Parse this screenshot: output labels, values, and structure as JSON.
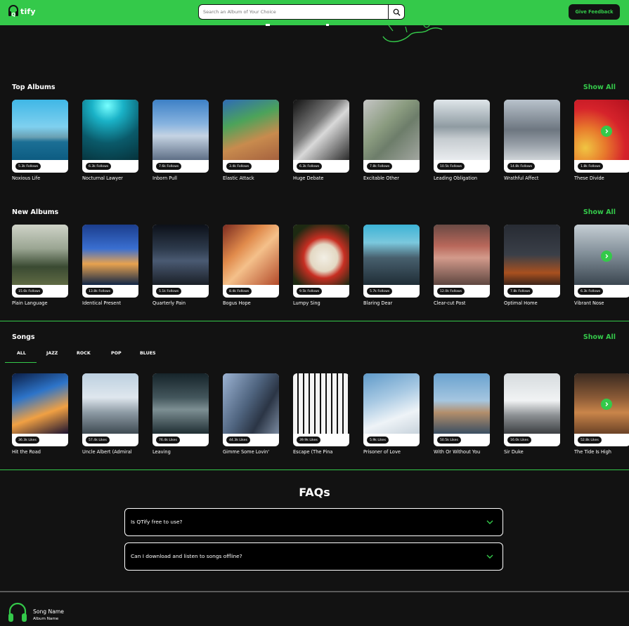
{
  "navbar": {
    "logo_text": "tify",
    "search_placeholder": "Search an Album of Your Choice",
    "feedback_label": "Give Feedback"
  },
  "colors": {
    "accent": "#34c94a",
    "background": "#121212"
  },
  "top_albums": {
    "title": "Top Albums",
    "show_all": "Show All",
    "cards": [
      {
        "title": "Noxious Life",
        "badge": "5.3k Follows"
      },
      {
        "title": "Nocturnal Lawyer",
        "badge": "6.3k Follows"
      },
      {
        "title": "Inborn Pull",
        "badge": "7.6k Follows"
      },
      {
        "title": "Elastic Attack",
        "badge": "3.4k Follows"
      },
      {
        "title": "Huge Debate",
        "badge": "6.3k Follows"
      },
      {
        "title": "Excitable Other",
        "badge": "7.8k Follows"
      },
      {
        "title": "Leading Obligation",
        "badge": "10.5k Follows"
      },
      {
        "title": "Wrathful Affect",
        "badge": "14.8k Follows"
      },
      {
        "title": "These Divide",
        "badge": "1.8k Follows"
      }
    ]
  },
  "new_albums": {
    "title": "New Albums",
    "show_all": "Show All",
    "cards": [
      {
        "title": "Plain Language",
        "badge": "15.6k Follows"
      },
      {
        "title": "Identical Present",
        "badge": "13.8k Follows"
      },
      {
        "title": "Quarterly Pain",
        "badge": "5.1k Follows"
      },
      {
        "title": "Bogus Hope",
        "badge": "8.4k Follows"
      },
      {
        "title": "Lumpy Sing",
        "badge": "9.5k Follows"
      },
      {
        "title": "Blaring Dear",
        "badge": "5.7k Follows"
      },
      {
        "title": "Clear-cut Post",
        "badge": "12.0k Follows"
      },
      {
        "title": "Optimal Home",
        "badge": "7.8k Follows"
      },
      {
        "title": "Vibrant Nose",
        "badge": "6.3k Follows"
      }
    ]
  },
  "songs": {
    "title": "Songs",
    "show_all": "Show All",
    "tabs": [
      "ALL",
      "JAZZ",
      "ROCK",
      "POP",
      "BLUES"
    ],
    "cards": [
      {
        "title": "Hit the Road",
        "badge": "36.3k Likes"
      },
      {
        "title": "Uncle Albert (Admiral",
        "badge": "57.4k Likes"
      },
      {
        "title": "Leaving",
        "badge": "76.4k Likes"
      },
      {
        "title": "Gimme Some Lovin'",
        "badge": "44.3k Likes"
      },
      {
        "title": "Escape (The Pina",
        "badge": "39.9k Likes"
      },
      {
        "title": "Prisoner of Love",
        "badge": "5.9k Likes"
      },
      {
        "title": "With Or Without You",
        "badge": "50.5k Likes"
      },
      {
        "title": "Sir Duke",
        "badge": "16.0k Likes"
      },
      {
        "title": "The Tide Is High",
        "badge": "52.8k Likes"
      }
    ]
  },
  "faqs": {
    "title": "FAQs",
    "items": [
      {
        "question": "Is QTify free to use?"
      },
      {
        "question": "Can I download and listen to songs offline?"
      }
    ]
  },
  "player": {
    "song_name": "Song Name",
    "album_name": "Album Name"
  }
}
